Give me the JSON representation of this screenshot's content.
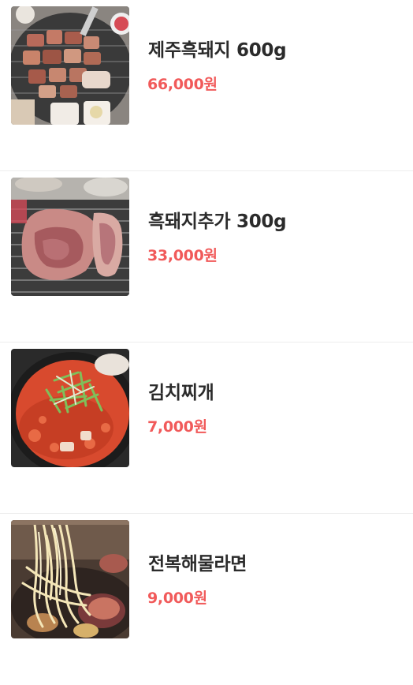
{
  "menu": {
    "items": [
      {
        "image": "grilled-pork-belly-photo",
        "name": "제주흑돼지 600g",
        "price": "66,000원"
      },
      {
        "image": "pork-neck-on-grill-photo",
        "name": "흑돼지추가 300g",
        "price": "33,000원"
      },
      {
        "image": "kimchi-stew-photo",
        "name": "김치찌개",
        "price": "7,000원"
      },
      {
        "image": "abalone-seafood-ramen-photo",
        "name": "전복해물라면",
        "price": "9,000원"
      }
    ]
  },
  "colors": {
    "name_text": "#2b2b2b",
    "price_text": "#f15a5a",
    "divider": "#ececec"
  }
}
